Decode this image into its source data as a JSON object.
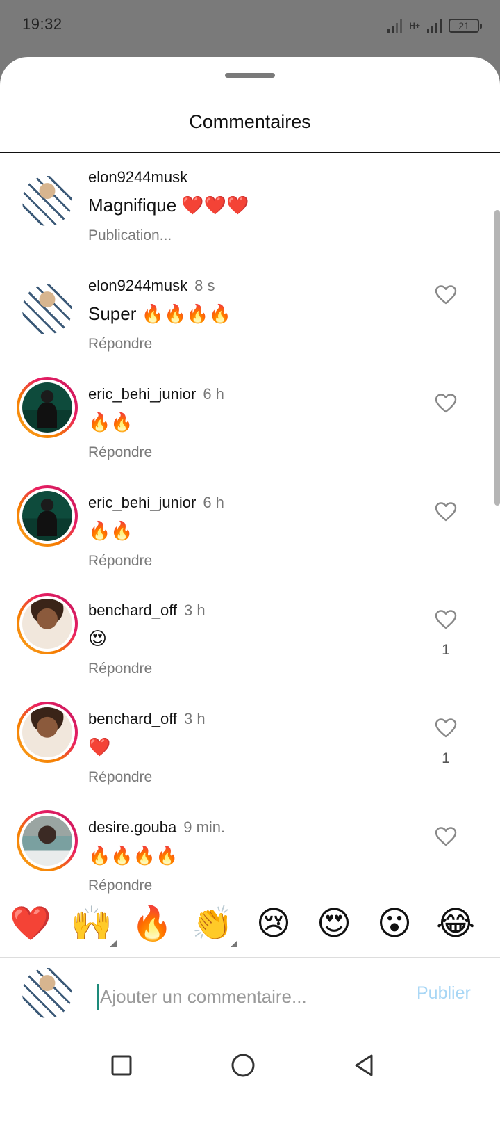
{
  "status_bar": {
    "time": "19:32",
    "network": "H+",
    "battery": "21"
  },
  "sheet": {
    "title": "Commentaires"
  },
  "comments": [
    {
      "username": "elon9244musk",
      "time": "",
      "text": "Magnifique ❤️❤️❤️",
      "action": "Publication...",
      "likes": "",
      "avatar": "elon",
      "story_ring": false,
      "has_like": false
    },
    {
      "username": "elon9244musk",
      "time": "8 s",
      "text": "Super 🔥🔥🔥🔥",
      "action": "Répondre",
      "likes": "",
      "avatar": "elon",
      "story_ring": false,
      "has_like": true
    },
    {
      "username": "eric_behi_junior",
      "time": "6 h",
      "text": "🔥🔥",
      "action": "Répondre",
      "likes": "",
      "avatar": "eric",
      "story_ring": true,
      "has_like": true
    },
    {
      "username": "eric_behi_junior",
      "time": "6 h",
      "text": "🔥🔥",
      "action": "Répondre",
      "likes": "",
      "avatar": "eric",
      "story_ring": true,
      "has_like": true
    },
    {
      "username": "benchard_off",
      "time": "3 h",
      "text": "😍",
      "action": "Répondre",
      "likes": "1",
      "avatar": "ben",
      "story_ring": true,
      "has_like": true
    },
    {
      "username": "benchard_off",
      "time": "3 h",
      "text": "❤️",
      "action": "Répondre",
      "likes": "1",
      "avatar": "ben",
      "story_ring": true,
      "has_like": true
    },
    {
      "username": "desire.gouba",
      "time": "9 min.",
      "text": "🔥🔥🔥🔥",
      "action": "Répondre",
      "likes": "",
      "avatar": "desire",
      "story_ring": true,
      "has_like": true
    }
  ],
  "reactions": [
    "❤️",
    "🙌",
    "🔥",
    "👏",
    "😢",
    "😍",
    "😮",
    "😂"
  ],
  "reactions_with_skin_tone": [
    1,
    3
  ],
  "composer": {
    "placeholder": "Ajouter un commentaire...",
    "publish_label": "Publier",
    "publish_color": "#a7d6f5"
  },
  "navbar": {
    "items": [
      "recent-apps",
      "home",
      "back"
    ]
  }
}
